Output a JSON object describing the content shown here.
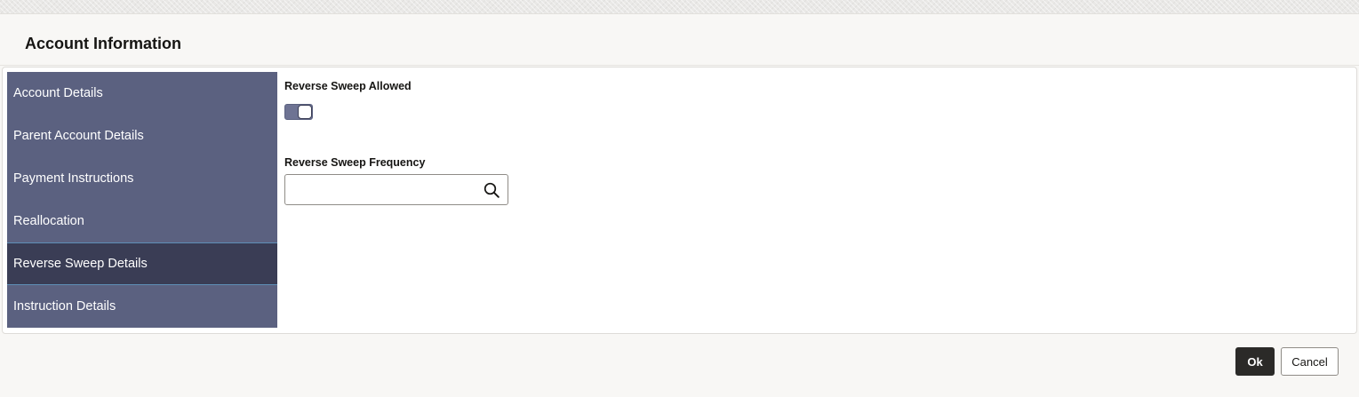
{
  "dialog": {
    "title": "Account Information"
  },
  "sidebar": {
    "items": [
      {
        "label": "Account Details"
      },
      {
        "label": "Parent Account Details"
      },
      {
        "label": "Payment Instructions"
      },
      {
        "label": "Reallocation"
      },
      {
        "label": "Reverse Sweep Details"
      },
      {
        "label": "Instruction Details"
      }
    ],
    "active_index": 4
  },
  "form": {
    "reverse_sweep_allowed": {
      "label": "Reverse Sweep Allowed",
      "value": true
    },
    "reverse_sweep_frequency": {
      "label": "Reverse Sweep Frequency",
      "value": "",
      "placeholder": ""
    }
  },
  "footer": {
    "ok_label": "Ok",
    "cancel_label": "Cancel"
  },
  "colors": {
    "sidebar_bg": "#5b6180",
    "sidebar_active_bg": "#3a3d55",
    "primary_button": "#2b2a28"
  },
  "icons": {
    "search": "search-icon"
  }
}
